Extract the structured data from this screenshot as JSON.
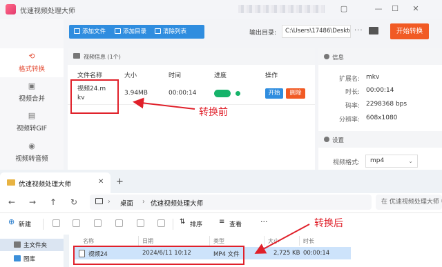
{
  "app": {
    "title": "优速视频处理大师",
    "window_controls": [
      "▢",
      "—",
      "☐",
      "✕"
    ]
  },
  "sidebar": {
    "items": [
      {
        "label": "格式转换",
        "icon": "convert-icon",
        "active": true
      },
      {
        "label": "视频合并",
        "icon": "merge-icon",
        "active": false
      },
      {
        "label": "视频转GIF",
        "icon": "gif-icon",
        "active": false
      },
      {
        "label": "视频转音频",
        "icon": "audio-icon",
        "active": false
      }
    ]
  },
  "toolbar": {
    "add_file": "添加文件",
    "add_dir": "添加目录",
    "clear_list": "清除列表",
    "output_label": "输出目录:",
    "output_path": "C:\\Users\\17486\\Deskto",
    "more": "···",
    "start_all": "开始转换"
  },
  "file_list": {
    "header": "视频信息 (1个)",
    "columns": [
      "文件名称",
      "大小",
      "时间",
      "进度",
      "操作"
    ],
    "rows": [
      {
        "name": "视频24.mkv",
        "size": "3.94MB",
        "time": "00:00:14",
        "progress": 1.0,
        "start": "开始",
        "delete": "删除"
      }
    ]
  },
  "info": {
    "header": "信息",
    "fields": [
      {
        "key": "扩展名:",
        "value": "mkv"
      },
      {
        "key": "时长:",
        "value": "00:00:14"
      },
      {
        "key": "码率:",
        "value": "2298368 bps"
      },
      {
        "key": "分辨率:",
        "value": "608x1080"
      }
    ],
    "settings_header": "设置",
    "format_label": "视频格式:",
    "format_value": "mp4"
  },
  "explorer": {
    "tab_title": "优速视频处理大师",
    "tab_close": "✕",
    "tab_add": "+",
    "breadcrumb": [
      "桌面",
      "优速视频处理大师"
    ],
    "search_placeholder": "在 优速视频处理大师 中搜索",
    "commands": {
      "new": "新建",
      "sort": "排序",
      "view": "查看",
      "more": "···"
    },
    "nav": [
      {
        "label": "主文件夹",
        "selected": true
      },
      {
        "label": "图库",
        "selected": false
      }
    ],
    "columns": [
      "名称",
      "日期",
      "类型",
      "大小",
      "时长"
    ],
    "rows": [
      {
        "name": "视频24",
        "date": "2024/6/11 10:12",
        "type": "MP4 文件",
        "size": "2,725 KB",
        "duration": "00:00:14"
      }
    ]
  },
  "annotations": {
    "before": "转换前",
    "after": "转换后",
    "color": "#e0202a"
  },
  "colors": {
    "accent_blue": "#2f8ddf",
    "accent_orange": "#f15a24",
    "progress_green": "#16b36a"
  }
}
